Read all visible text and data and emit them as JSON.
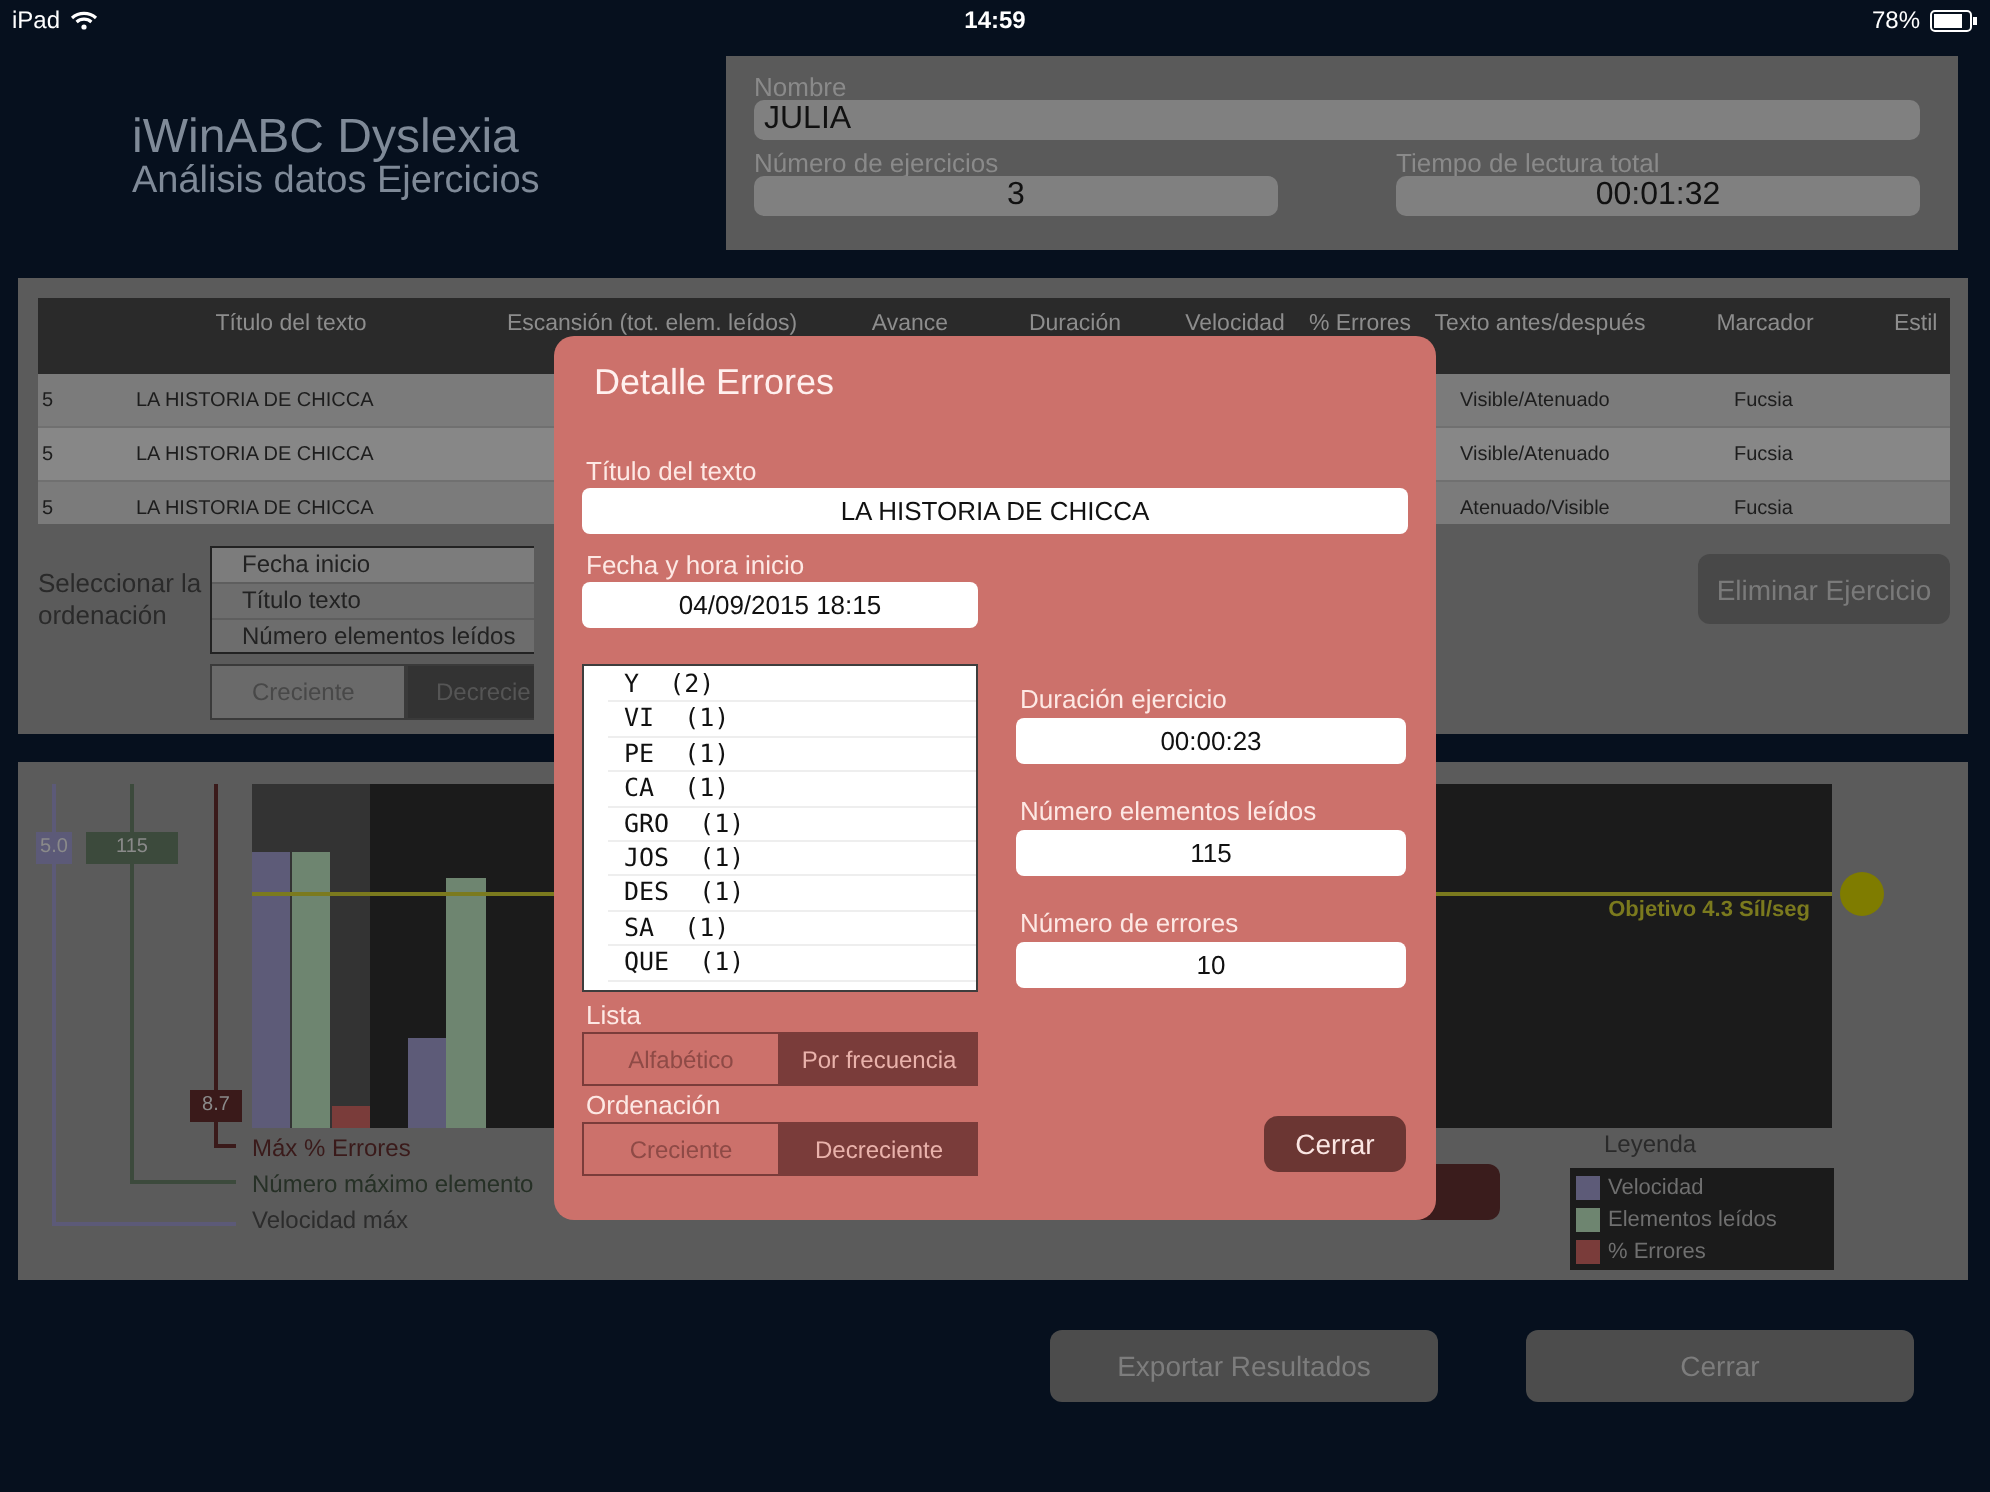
{
  "status_bar": {
    "device": "iPad",
    "time": "14:59",
    "battery": "78%"
  },
  "header": {
    "title": "iWinABC Dyslexia",
    "subtitle": "Análisis datos Ejercicios"
  },
  "student": {
    "name_label": "Nombre",
    "name": "JULIA",
    "exercises_label": "Número de ejercicios",
    "exercises": "3",
    "time_label": "Tiempo de lectura total",
    "time": "00:01:32"
  },
  "table": {
    "columns": [
      "Título del texto",
      "Escansión (tot. elem. leídos)",
      "Avance",
      "Duración",
      "Velocidad",
      "% Errores",
      "Texto antes/después",
      "Marcador",
      "Estil"
    ],
    "rows": [
      {
        "column_1": "5",
        "title": "LA HISTORIA DE CHICCA",
        "text_before_after": "Visible/Atenuado",
        "marker": "Fucsia"
      },
      {
        "column_1": "5",
        "title": "LA HISTORIA DE CHICCA",
        "text_before_after": "Visible/Atenuado",
        "marker": "Fucsia"
      },
      {
        "column_1": "5",
        "title": "LA HISTORIA DE CHICCA",
        "text_before_after": "Atenuado/Visible",
        "marker": "Fucsia"
      }
    ]
  },
  "sort": {
    "label": "Seleccionar la ordenación",
    "options": [
      {
        "label": "Fecha inicio",
        "selected": true
      },
      {
        "label": "Título texto",
        "selected": false
      },
      {
        "label": "Número elementos leídos",
        "selected": false
      }
    ],
    "order": [
      {
        "label": "Creciente",
        "selected": false
      },
      {
        "label": "Decrecie",
        "selected": true
      }
    ],
    "delete_button": "Eliminar Ejercicio"
  },
  "chart": {
    "axes": [
      {
        "value": "5.0",
        "color": "#5c5a78"
      },
      {
        "value": "115",
        "color": "#3c4a3c"
      },
      {
        "value": "8.7",
        "color": "#3a1a1a"
      }
    ],
    "axis_captions": [
      "Máx % Errores",
      "Número máximo elemento",
      "Velocidad máx"
    ],
    "goal": "Objetivo 4.3 Síl/seg",
    "legend_title": "Leyenda",
    "legend": [
      {
        "label": "Velocidad",
        "color": "#5d5b78"
      },
      {
        "label": "Elementos leídos",
        "color": "#6e8570"
      },
      {
        "label": "% Errores",
        "color": "#7a3c3a"
      }
    ]
  },
  "buttons": [
    "Exportar Resultados",
    "Cerrar"
  ],
  "dialog": {
    "title": "Detalle Errores",
    "text_title_label": "Título del texto",
    "text_title": "LA HISTORIA DE CHICCA",
    "start_label": "Fecha y hora inicio",
    "start": "04/09/2015 18:15",
    "errors": [
      "Y  (2)",
      "VI  (1)",
      "PE  (1)",
      "CA  (1)",
      "GRO  (1)",
      "JOS  (1)",
      "DES  (1)",
      "SA  (1)",
      "QUE  (1)"
    ],
    "duration_label": "Duración ejercicio",
    "duration": "00:00:23",
    "elements_label": "Número elementos leídos",
    "elements": "115",
    "errors_label": "Número de errores",
    "errors_count": "10",
    "list_label": "Lista",
    "list_modes": [
      {
        "label": "Alfabético",
        "selected": false
      },
      {
        "label": "Por frecuencia",
        "selected": true
      }
    ],
    "order_label": "Ordenación",
    "order_modes": [
      {
        "label": "Creciente",
        "selected": false
      },
      {
        "label": "Decreciente",
        "selected": true
      }
    ],
    "close": "Cerrar"
  }
}
